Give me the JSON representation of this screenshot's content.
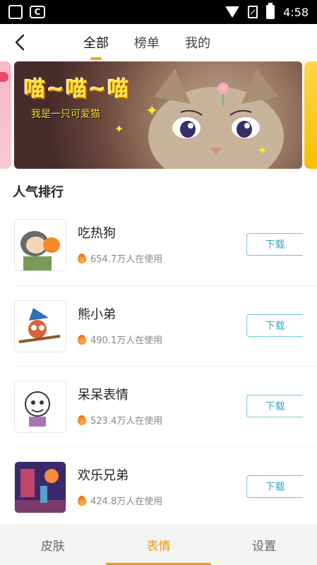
{
  "status_bar": {
    "time": "4:58"
  },
  "nav": {
    "tabs": [
      {
        "label": "全部",
        "active": true
      },
      {
        "label": "榜单",
        "active": false
      },
      {
        "label": "我的",
        "active": false
      }
    ]
  },
  "banner": {
    "title": "喵~喵~喵",
    "subtitle": "我是一只可爱猫"
  },
  "section": {
    "title": "人气排行"
  },
  "items": [
    {
      "name": "吃热狗",
      "usage": "654.7万人在使用",
      "button": "下载"
    },
    {
      "name": "熊小弟",
      "usage": "490.1万人在使用",
      "button": "下载"
    },
    {
      "name": "呆呆表情",
      "usage": "523.4万人在使用",
      "button": "下载"
    },
    {
      "name": "欢乐兄弟",
      "usage": "424.8万人在使用",
      "button": "下载"
    }
  ],
  "bottom_nav": {
    "items": [
      {
        "label": "皮肤",
        "active": false
      },
      {
        "label": "表情",
        "active": true
      },
      {
        "label": "设置",
        "active": false
      }
    ]
  },
  "colors": {
    "accent": "#f59b00",
    "download": "#37aab9",
    "banner_text": "#ffe33a"
  },
  "icons": [
    "back-arrow-icon",
    "wifi-icon",
    "sim-icon",
    "battery-icon",
    "fire-icon"
  ]
}
